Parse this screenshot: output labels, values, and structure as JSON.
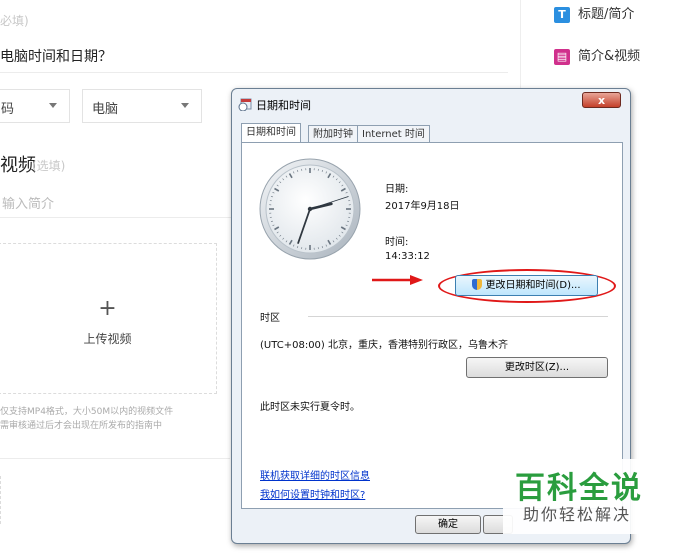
{
  "editor": {
    "optional_hint_1": "必填)",
    "question": "电脑时间和日期？",
    "select1_value": "码",
    "select2_value": "电脑",
    "video_section_title": "视频",
    "video_optional": "(选填)",
    "video_intro_placeholder": "输入简介",
    "upload_plus": "+",
    "upload_label": "上传视频",
    "upload_note_1": "仅支持MP4格式，大小50M以内的视频文件",
    "upload_note_2": "需审核通过后才会出现在所发布的指南中"
  },
  "right_nav": {
    "items": [
      {
        "icon": "T",
        "label": "标题/简介",
        "color": "#2b8fe0"
      },
      {
        "icon": "▤",
        "label": "简介&视频",
        "color": "#d0308c"
      }
    ]
  },
  "dialog": {
    "title": "日期和时间",
    "close_label": "x",
    "tabs": [
      "日期和时间",
      "附加时钟",
      "Internet 时间"
    ],
    "date_label": "日期:",
    "date_value": "2017年9月18日",
    "time_label": "时间:",
    "time_value": "14:33:12",
    "change_datetime_button": "更改日期和时间(D)...",
    "timezone_header": "时区",
    "timezone_value": "(UTC+08:00) 北京，重庆，香港特别行政区，乌鲁木齐",
    "change_timezone_button": "更改时区(Z)...",
    "dst_note": "此时区未实行夏令时。",
    "link_timezone_info": "联机获取详细的时区信息",
    "link_how_to_set": "我如何设置时钟和时区?",
    "ok_button": "确定",
    "clock": {
      "hour": 14,
      "minute": 33,
      "second": 12
    }
  },
  "watermark": {
    "title": "百科全说",
    "subtitle": "助你轻松解决"
  },
  "colors": {
    "highlight_ellipse": "#e01818",
    "arrow": "#e01818",
    "accent_green": "#2a9d3e"
  }
}
